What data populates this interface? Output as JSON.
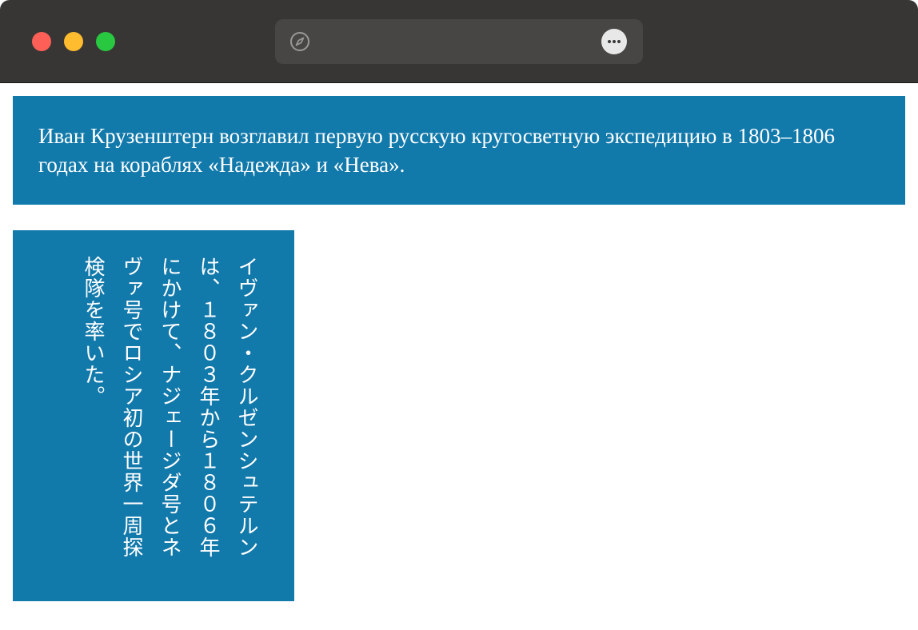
{
  "browser": {
    "url_text": "",
    "icons": {
      "compass": "compass-icon",
      "more": "more-options-icon"
    },
    "colors": {
      "titlebar": "#383634",
      "close": "#fe5f57",
      "minimize": "#febc2e",
      "zoom": "#28c840"
    }
  },
  "content": {
    "banner_text": "Иван Крузенштерн возглавил первую русскую кругосветную экспедицию в 1803–1806 годах на кораблях «Надежда» и «Нева».",
    "vertical_text": "イヴァン・クルゼンシュテルンは、１８０３年から１８０６年にかけて、ナジェージダ号とネヴァ号でロシア初の世界一周探検隊を率いた。",
    "accent_color": "#1279ab"
  }
}
